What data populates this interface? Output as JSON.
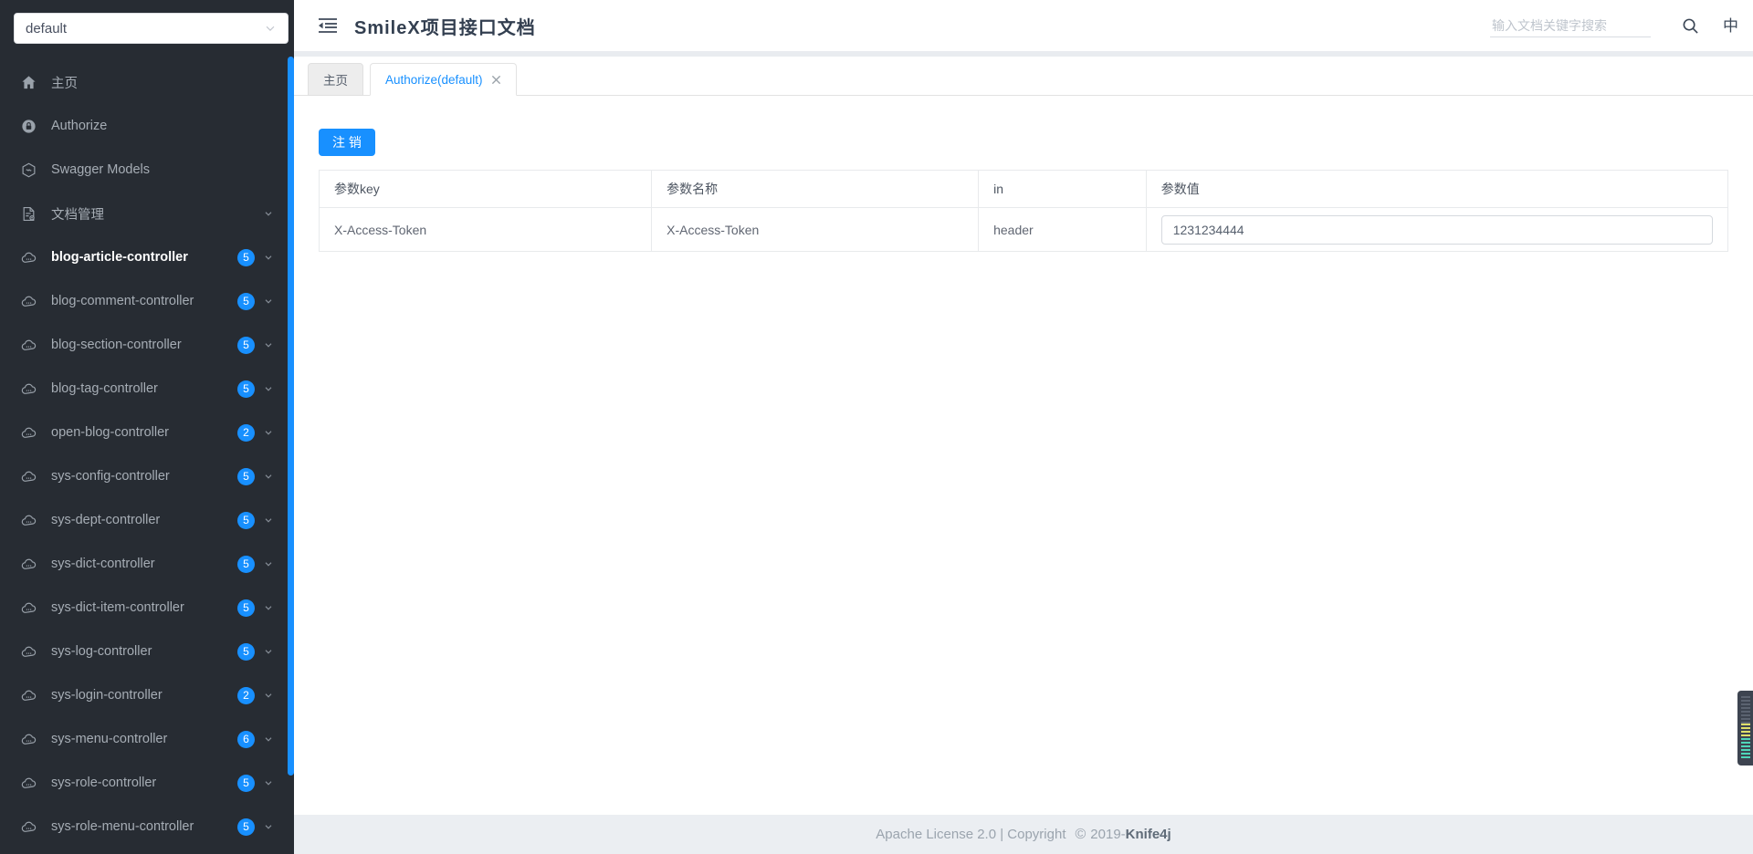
{
  "colors": {
    "primary": "#1890ff",
    "sidebar_bg": "#272c33"
  },
  "sidebar": {
    "group_select": {
      "value": "default"
    },
    "items": [
      {
        "label": "主页",
        "icon": "home-icon"
      },
      {
        "label": "Authorize",
        "icon": "lock-icon"
      },
      {
        "label": "Swagger Models",
        "icon": "models-icon"
      },
      {
        "label": "文档管理",
        "icon": "document-icon",
        "chevron": true
      },
      {
        "label": "blog-article-controller",
        "icon": "api-icon",
        "badge": "5",
        "chevron": true,
        "active": true
      },
      {
        "label": "blog-comment-controller",
        "icon": "api-icon",
        "badge": "5",
        "chevron": true
      },
      {
        "label": "blog-section-controller",
        "icon": "api-icon",
        "badge": "5",
        "chevron": true
      },
      {
        "label": "blog-tag-controller",
        "icon": "api-icon",
        "badge": "5",
        "chevron": true
      },
      {
        "label": "open-blog-controller",
        "icon": "api-icon",
        "badge": "2",
        "chevron": true
      },
      {
        "label": "sys-config-controller",
        "icon": "api-icon",
        "badge": "5",
        "chevron": true
      },
      {
        "label": "sys-dept-controller",
        "icon": "api-icon",
        "badge": "5",
        "chevron": true
      },
      {
        "label": "sys-dict-controller",
        "icon": "api-icon",
        "badge": "5",
        "chevron": true
      },
      {
        "label": "sys-dict-item-controller",
        "icon": "api-icon",
        "badge": "5",
        "chevron": true
      },
      {
        "label": "sys-log-controller",
        "icon": "api-icon",
        "badge": "5",
        "chevron": true
      },
      {
        "label": "sys-login-controller",
        "icon": "api-icon",
        "badge": "2",
        "chevron": true
      },
      {
        "label": "sys-menu-controller",
        "icon": "api-icon",
        "badge": "6",
        "chevron": true
      },
      {
        "label": "sys-role-controller",
        "icon": "api-icon",
        "badge": "5",
        "chevron": true
      },
      {
        "label": "sys-role-menu-controller",
        "icon": "api-icon",
        "badge": "5",
        "chevron": true
      }
    ]
  },
  "header": {
    "title": "SmileX项目接口文档",
    "search_placeholder": "输入文档关键字搜索",
    "lang_icon_label": "中"
  },
  "tabs": [
    {
      "label": "主页",
      "active": false,
      "closable": false
    },
    {
      "label": "Authorize(default)",
      "active": true,
      "closable": true
    }
  ],
  "authorize": {
    "logout_button": "注 销",
    "table": {
      "headers": [
        "参数key",
        "参数名称",
        "in",
        "参数值"
      ],
      "rows": [
        {
          "key": "X-Access-Token",
          "name": "X-Access-Token",
          "in": "header",
          "value": "1231234444"
        }
      ]
    }
  },
  "footer": {
    "license_text": "Apache License 2.0 | Copyright",
    "copyright_symbol": "©",
    "year_prefix": "2019-",
    "brand": "Knife4j"
  }
}
